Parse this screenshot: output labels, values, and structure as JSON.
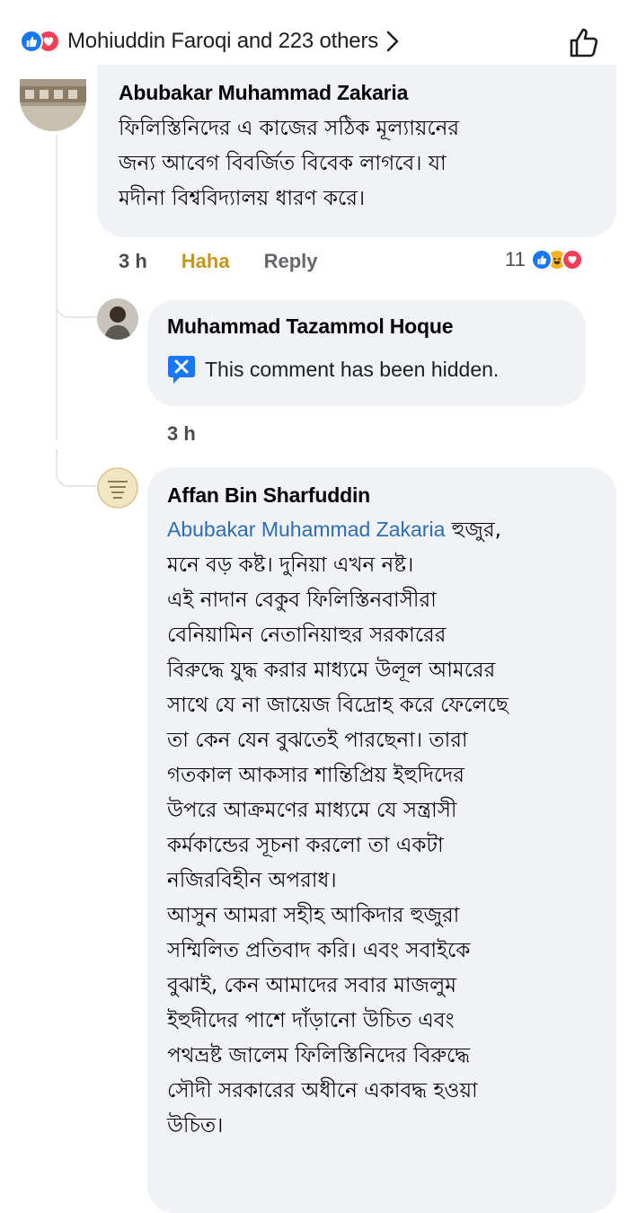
{
  "reactions_summary": {
    "text": "Mohiuddin Faroqi and 223 others"
  },
  "comments": [
    {
      "author": "Abubakar Muhammad Zakaria",
      "lines": [
        "ফিলিস্তিনিদের এ কাজের সঠিক মূল্যায়নের",
        "জন্য আবেগ বিবর্জিত বিবেক লাগবে। যা",
        "মদীনা বিশ্ববিদ্যালয় ধারণ করে।"
      ],
      "time": "3 h",
      "reaction_label": "Haha",
      "reply_label": "Reply",
      "reaction_count": "11"
    },
    {
      "author": "Muhammad Tazammol Hoque",
      "hidden_text": "This comment has been hidden.",
      "time": "3 h"
    },
    {
      "author": "Affan Bin Sharfuddin",
      "mention": "Abubakar Muhammad Zakaria",
      "first_line_rest": " হুজুর,",
      "lines": [
        "মনে বড় কষ্ট। দুনিয়া এখন নষ্ট।",
        "এই নাদান বেকুব ফিলিস্তিনবাসীরা",
        "বেনিয়ামিন নেতানিয়াহুর সরকারের",
        "বিরুদ্ধে যুদ্ধ করার মাধ্যমে উলূল আমরের",
        "সাথে যে না জায়েজ বিদ্রোহ করে ফেলেছে",
        "তা কেন যেন বুঝতেই পারছেনা। তারা",
        "গতকাল আকসার শান্তিপ্রিয় ইহুদিদের",
        "উপরে আক্রমণের মাধ্যমে যে সন্ত্রাসী",
        "কর্মকান্ডের সূচনা করলো তা একটা",
        "নজিরবিহীন অপরাধ।",
        "আসুন আমরা সহীহ আকিদার হুজুরা",
        "সম্মিলিত প্রতিবাদ করি। এবং সবাইকে",
        "বুঝাই, কেন আমাদের সবার মাজলুম",
        "ইহুদীদের পাশে দাঁড়ানো উচিত এবং",
        "পথভ্রষ্ট জালেম ফিলিস্তিনিদের বিরুদ্ধে",
        "সৌদী সরকারের অধীনে একাবদ্ধ হওয়া",
        "উচিত।"
      ]
    }
  ],
  "colors": {
    "bubble": "#f0f2f5",
    "haha": "#c5961b",
    "meta": "#65676b",
    "like_blue": "#1877f2",
    "love_red": "#f33e58",
    "mention": "#2d6db5"
  }
}
